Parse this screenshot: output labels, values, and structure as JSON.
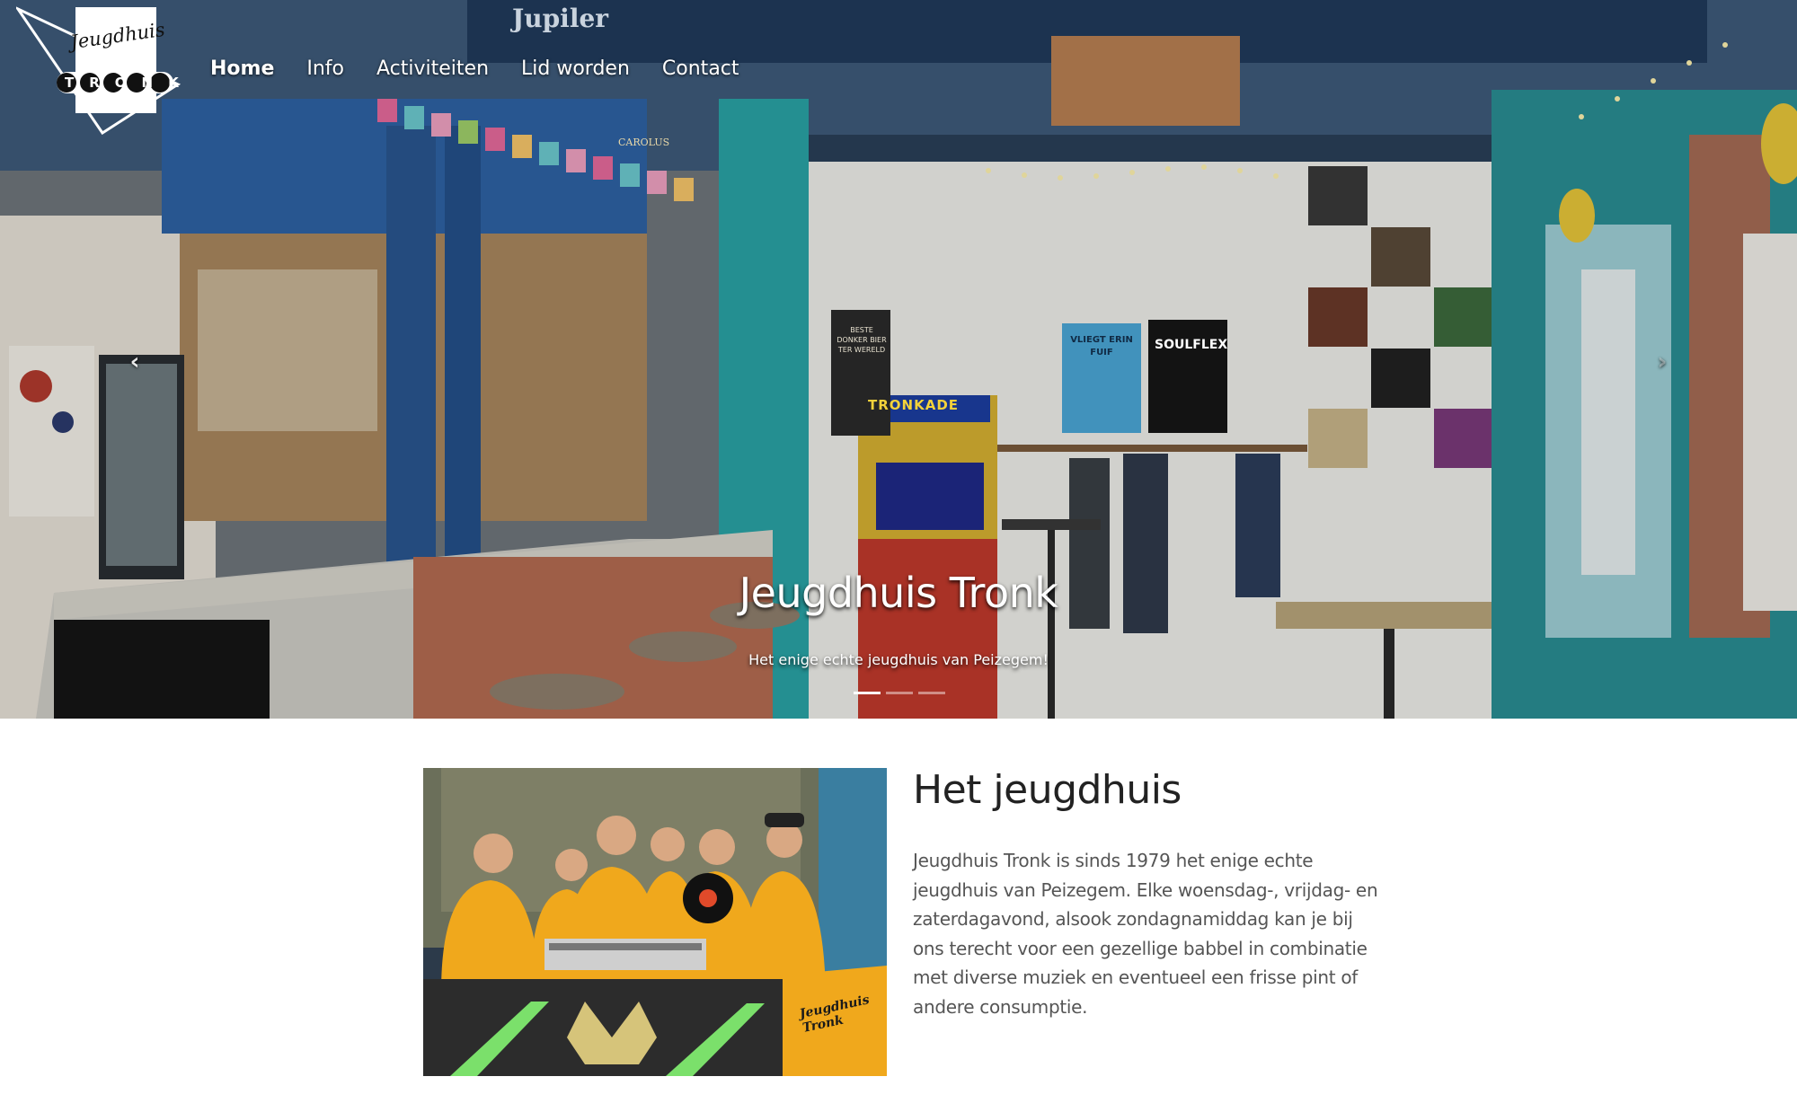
{
  "brand": {
    "logo_text_top": "Jeugdhuis",
    "logo_text_bottom": "TRONK"
  },
  "nav": {
    "items": [
      {
        "label": "Home",
        "active": true
      },
      {
        "label": "Info",
        "active": false
      },
      {
        "label": "Activiteiten",
        "active": false
      },
      {
        "label": "Lid worden",
        "active": false
      },
      {
        "label": "Contact",
        "active": false
      }
    ]
  },
  "hero": {
    "title": "Jeugdhuis Tronk",
    "subtitle": "Het enige echte jeugdhuis van Peizegem!",
    "prev_icon": "chevron-left-icon",
    "next_icon": "chevron-right-icon",
    "slides_count": 3,
    "active_slide": 1,
    "photo_signs": {
      "beer_sign": "Jupiler",
      "bar_sign": "CAROLUS",
      "arcade": "TRONKADE",
      "poster_1": "VLIEGT ERIN FUIF",
      "poster_2": "SOULFLEX",
      "poster_3": "BESTE DONKER BIER TER WERELD"
    }
  },
  "about": {
    "title": "Het jeugdhuis",
    "text": "Jeugdhuis Tronk is sinds 1979 het enige echte jeugdhuis van Peizegem. Elke woensdag-, vrijdag- en zaterdagavond, alsook zondagnamiddag kan je bij ons terecht voor een gezellige babbel in combinatie met diverse muziek en eventueel een frisse pint of andere consumptie.",
    "photo_text": "Jeugdhuis Tronk"
  },
  "colors": {
    "accent_yellow": "#f0a81c",
    "wall_teal": "#2a9ba0",
    "bar_blue": "#23508a",
    "text_dark": "#222222",
    "text_body": "#555555"
  }
}
